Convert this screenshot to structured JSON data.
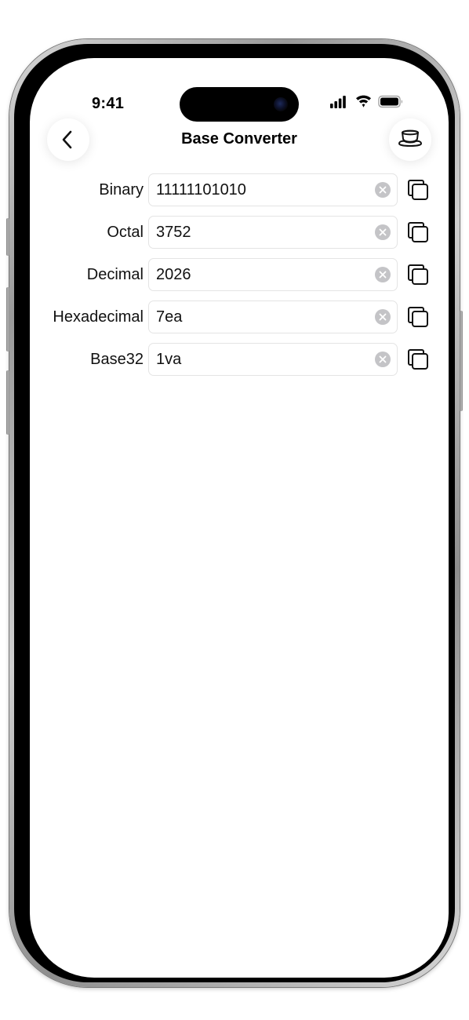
{
  "status_bar": {
    "time": "9:41",
    "icons": [
      "signal-icon",
      "wifi-icon",
      "battery-icon"
    ]
  },
  "nav": {
    "title": "Base Converter",
    "back_icon": "chevron-left-icon",
    "coffee_icon": "coffee-cup-icon"
  },
  "converter": {
    "rows": [
      {
        "label": "Binary",
        "value": "11111101010"
      },
      {
        "label": "Octal",
        "value": "3752"
      },
      {
        "label": "Decimal",
        "value": "2026"
      },
      {
        "label": "Hexadecimal",
        "value": "7ea"
      },
      {
        "label": "Base32",
        "value": "1va"
      }
    ],
    "clear_icon": "clear-circle-icon",
    "copy_icon": "copy-icon"
  },
  "colors": {
    "background": "#ffffff",
    "text": "#111111",
    "field_border": "#e4e4e4",
    "clear_icon": "#c4c4c7"
  }
}
